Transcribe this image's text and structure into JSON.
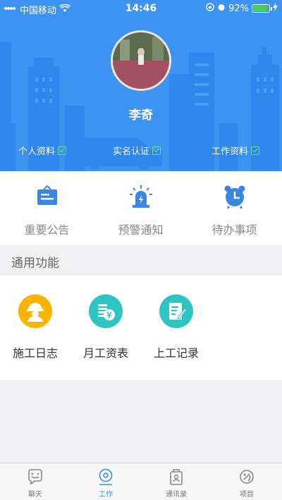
{
  "status_bar": {
    "carrier": "中国移动",
    "time": "14:46",
    "battery": "92%",
    "battery_level": 0.92
  },
  "profile": {
    "name": "李奇",
    "tags": [
      "个人资料",
      "实名认证",
      "工作资料"
    ]
  },
  "quick_actions": [
    {
      "label": "重要公告",
      "icon": "announcement-board-icon"
    },
    {
      "label": "预警通知",
      "icon": "alarm-light-icon"
    },
    {
      "label": "待办事项",
      "icon": "alarm-clock-icon"
    }
  ],
  "section": {
    "title": "通用功能"
  },
  "functions": [
    {
      "label": "施工日志",
      "icon": "worker-helmet-icon",
      "color": "#f7b500"
    },
    {
      "label": "月工资表",
      "icon": "coins-yen-icon",
      "color": "#2ec4c4"
    },
    {
      "label": "上工记录",
      "icon": "document-edit-icon",
      "color": "#2ec4c4"
    }
  ],
  "tabbar": {
    "items": [
      {
        "label": "聊天",
        "icon": "chat-icon"
      },
      {
        "label": "工作",
        "icon": "work-icon",
        "active": true
      },
      {
        "label": "通讯录",
        "icon": "contacts-icon"
      },
      {
        "label": "项目",
        "icon": "project-icon"
      }
    ]
  },
  "colors": {
    "header_blue": "#3d93f2",
    "accent": "#3d8ef0",
    "check_green": "#6ee38a"
  }
}
